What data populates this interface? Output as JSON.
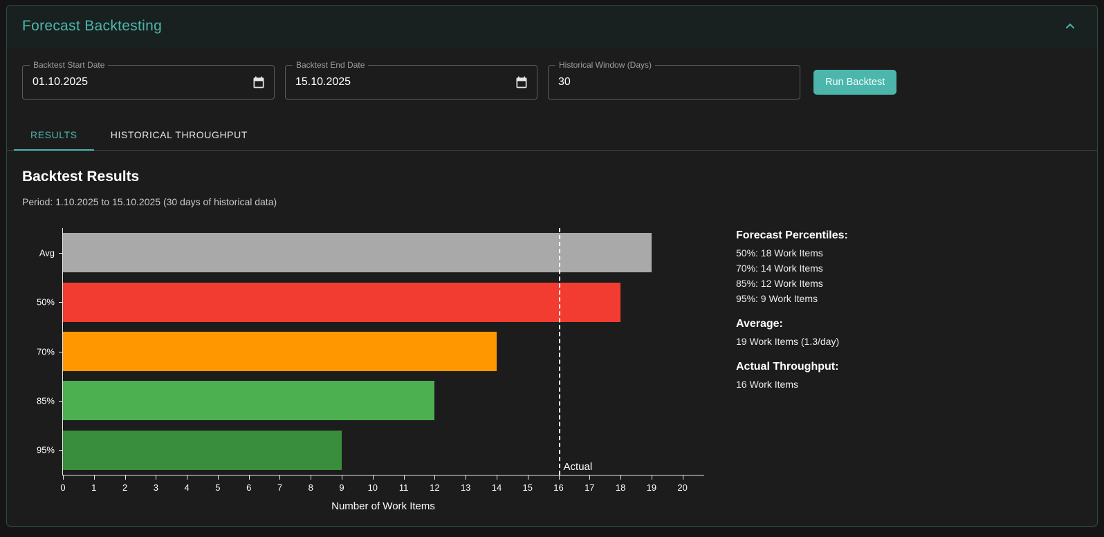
{
  "panel": {
    "title": "Forecast Backtesting"
  },
  "form": {
    "fields": [
      {
        "label": "Backtest Start Date",
        "value": "01.10.2025"
      },
      {
        "label": "Backtest End Date",
        "value": "15.10.2025"
      },
      {
        "label": "Historical Window (Days)",
        "value": "30"
      }
    ],
    "run_button": "Run Backtest"
  },
  "tabs": [
    {
      "label": "RESULTS",
      "active": true
    },
    {
      "label": "HISTORICAL THROUGHPUT",
      "active": false
    }
  ],
  "results": {
    "title": "Backtest Results",
    "period": "Period: 1.10.2025 to 15.10.2025 (30 days of historical data)"
  },
  "chart_data": {
    "type": "bar",
    "orientation": "horizontal",
    "categories": [
      "Avg",
      "50%",
      "70%",
      "85%",
      "95%"
    ],
    "values": [
      19,
      18,
      14,
      12,
      9
    ],
    "colors": [
      "#a9a9a9",
      "#f23c32",
      "#ff9800",
      "#4caf50",
      "#388e3c"
    ],
    "xlabel": "Number of Work Items",
    "xlim": [
      0,
      20
    ],
    "x_ticks": [
      0,
      1,
      2,
      3,
      4,
      5,
      6,
      7,
      8,
      9,
      10,
      11,
      12,
      13,
      14,
      15,
      16,
      17,
      18,
      19,
      20
    ],
    "actual": {
      "x": 16,
      "label": "Actual",
      "style": "dashed",
      "color": "#ffffff"
    },
    "grid": false,
    "legend": false
  },
  "summary": {
    "percentiles_title": "Forecast Percentiles:",
    "percentiles": [
      "50%: 18 Work Items",
      "70%: 14 Work Items",
      "85%: 12 Work Items",
      "95%: 9 Work Items"
    ],
    "average_title": "Average:",
    "average_value": "19 Work Items (1.3/day)",
    "actual_title": "Actual Throughput:",
    "actual_value": "16 Work Items"
  },
  "colors": {
    "accent": "#4db6ac",
    "card_background": "#1c1c1c",
    "page_background": "#151515"
  }
}
